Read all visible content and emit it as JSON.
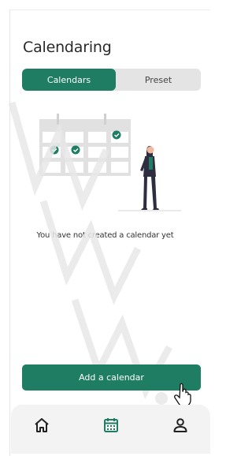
{
  "header": {
    "title": "Calendaring"
  },
  "tabs": [
    {
      "label": "Calendars",
      "active": true
    },
    {
      "label": "Preset",
      "active": false
    }
  ],
  "empty_state": {
    "message": "You have not created a calendar yet"
  },
  "actions": {
    "add_label": "Add a calendar"
  },
  "bottom_nav": [
    {
      "icon": "home-icon",
      "active": false
    },
    {
      "icon": "calendar-icon",
      "active": true
    },
    {
      "icon": "user-icon",
      "active": false
    }
  ],
  "colors": {
    "accent": "#1e7d62",
    "tab_bg": "#e4e4e4",
    "nav_bg": "#f3f3f3",
    "text": "#2a2a2a"
  }
}
